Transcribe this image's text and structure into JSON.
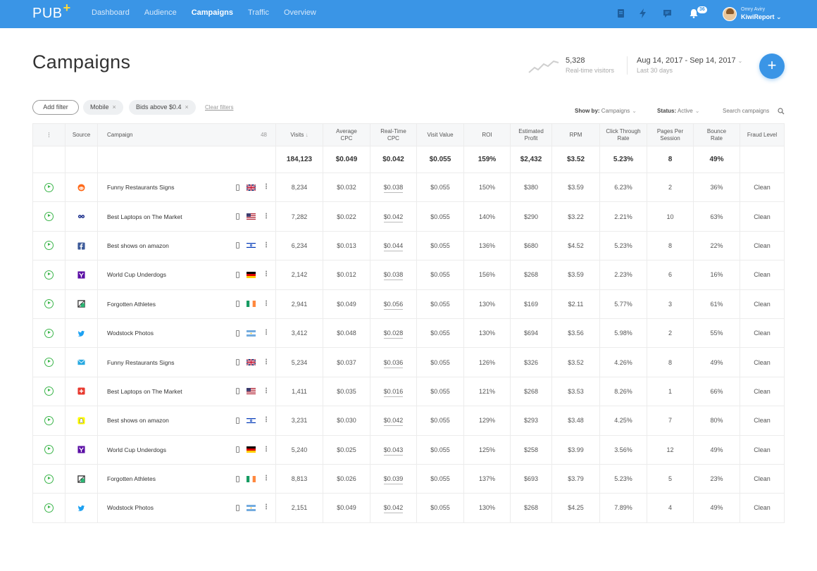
{
  "topbar": {
    "logo": "PUB",
    "logo_plus": "+",
    "nav": [
      "Dashboard",
      "Audience",
      "Campaigns",
      "Traffic",
      "Overview"
    ],
    "active_nav": "Campaigns",
    "notification_count": "36",
    "user_small": "Omry Aviry",
    "user_name": "KiwiReport",
    "user_chevron": "⌄",
    "icons": [
      "book-icon",
      "bolt-icon",
      "chat-icon",
      "bell-icon"
    ]
  },
  "header": {
    "title": "Campaigns",
    "realtime_value": "5,328",
    "realtime_label": "Real-time visitors",
    "date_range": "Aug 14, 2017 - Sep 14, 2017",
    "date_sub": "Last 30 days",
    "fab": "+"
  },
  "filters": {
    "add_filter": "Add filter",
    "chips": [
      "Mobile",
      "Bids above $0.4"
    ],
    "clear": "Clear filters",
    "show_by_label": "Show by:",
    "show_by_value": "Campaigns",
    "status_label": "Status:",
    "status_value": "Active",
    "search_placeholder": "Search campaigns"
  },
  "table": {
    "headers": {
      "source": "Source",
      "campaign": "Campaign",
      "campaign_count": "48",
      "visits": "Visits",
      "avg_cpc": [
        "Average",
        "CPC"
      ],
      "rt_cpc": [
        "Real-Time",
        "CPC"
      ],
      "visit_value": "Visit Value",
      "roi": "ROI",
      "est_profit": [
        "Estimated",
        "Profit"
      ],
      "rpm": "RPM",
      "ctr": [
        "Click Through",
        "Rate"
      ],
      "pps": [
        "Pages Per",
        "Session"
      ],
      "bounce": [
        "Bounce",
        "Rate"
      ],
      "fraud": "Fraud Level"
    },
    "totals": {
      "visits": "184,123",
      "avg_cpc": "$0.049",
      "rt_cpc": "$0.042",
      "visit_value": "$0.055",
      "roi": "159%",
      "est_profit": "$2,432",
      "rpm": "$3.52",
      "ctr": "5.23%",
      "pps": "8",
      "bounce": "49%"
    },
    "rows": [
      {
        "source": "reddit-icon",
        "campaign": "Funny Restaurants Signs",
        "flag": "uk",
        "visits": "8,234",
        "avg_cpc": "$0.032",
        "rt_cpc": "$0.038",
        "visit_value": "$0.055",
        "roi": "150%",
        "roi_color": "green",
        "est_profit": "$380",
        "rpm": "$3.59",
        "ctr": "6.23%",
        "pps": "2",
        "bounce": "36%",
        "fraud": "Clean"
      },
      {
        "source": "flickr-icon",
        "campaign": "Best Laptops on The Market",
        "flag": "us",
        "visits": "7,282",
        "avg_cpc": "$0.022",
        "rt_cpc": "$0.042",
        "visit_value": "$0.055",
        "roi": "140%",
        "roi_color": "green",
        "est_profit": "$290",
        "rpm": "$3.22",
        "ctr": "2.21%",
        "pps": "10",
        "bounce": "63%",
        "fraud": "Clean"
      },
      {
        "source": "facebook-icon",
        "campaign": "Best shows on amazon",
        "flag": "il",
        "visits": "6,234",
        "avg_cpc": "$0.013",
        "rt_cpc": "$0.044",
        "visit_value": "$0.055",
        "roi": "136%",
        "roi_color": "green",
        "est_profit": "$680",
        "rpm": "$4.52",
        "ctr": "5.23%",
        "pps": "8",
        "bounce": "22%",
        "fraud": "Clean"
      },
      {
        "source": "yahoo-icon",
        "campaign": "World Cup Underdogs",
        "flag": "de",
        "visits": "2,142",
        "avg_cpc": "$0.012",
        "rt_cpc": "$0.038",
        "visit_value": "$0.055",
        "roi": "156%",
        "roi_color": "green",
        "est_profit": "$268",
        "rpm": "$3.59",
        "ctr": "2.23%",
        "pps": "6",
        "bounce": "16%",
        "fraud": "Clean"
      },
      {
        "source": "bracket-icon",
        "campaign": "Forgotten Athletes",
        "flag": "ie",
        "visits": "2,941",
        "avg_cpc": "$0.049",
        "rt_cpc": "$0.056",
        "visit_value": "$0.055",
        "roi": "130%",
        "roi_color": "green",
        "est_profit": "$169",
        "rpm": "$2.11",
        "ctr": "5.77%",
        "pps": "3",
        "bounce": "61%",
        "fraud": "Clean"
      },
      {
        "source": "twitter-icon",
        "campaign": "Wodstock Photos",
        "flag": "ar",
        "visits": "3,412",
        "avg_cpc": "$0.048",
        "rt_cpc": "$0.028",
        "visit_value": "$0.055",
        "roi": "130%",
        "roi_color": "orange",
        "est_profit": "$694",
        "rpm": "$3.56",
        "ctr": "5.98%",
        "pps": "2",
        "bounce": "55%",
        "fraud": "Clean"
      },
      {
        "source": "mail-icon",
        "campaign": "Funny Restaurants Signs",
        "flag": "uk",
        "visits": "5,234",
        "avg_cpc": "$0.037",
        "rt_cpc": "$0.036",
        "visit_value": "$0.055",
        "roi": "126%",
        "roi_color": "orange",
        "est_profit": "$326",
        "rpm": "$3.52",
        "ctr": "4.26%",
        "pps": "8",
        "bounce": "49%",
        "fraud": "Clean"
      },
      {
        "source": "plus-icon",
        "campaign": "Best Laptops on The Market",
        "flag": "us",
        "visits": "1,411",
        "avg_cpc": "$0.035",
        "rt_cpc": "$0.016",
        "visit_value": "$0.055",
        "roi": "121%",
        "roi_color": "orange",
        "est_profit": "$268",
        "rpm": "$3.53",
        "ctr": "8.26%",
        "pps": "1",
        "bounce": "66%",
        "fraud": "Clean"
      },
      {
        "source": "snapchat-icon",
        "campaign": "Best shows on amazon",
        "flag": "il",
        "visits": "3,231",
        "avg_cpc": "$0.030",
        "rt_cpc": "$0.042",
        "visit_value": "$0.055",
        "roi": "129%",
        "roi_color": "orange",
        "est_profit": "$293",
        "rpm": "$3.48",
        "ctr": "4.25%",
        "pps": "7",
        "bounce": "80%",
        "fraud": "Clean"
      },
      {
        "source": "yahoo-icon",
        "campaign": "World Cup Underdogs",
        "flag": "de",
        "visits": "5,240",
        "avg_cpc": "$0.025",
        "rt_cpc": "$0.043",
        "visit_value": "$0.055",
        "roi": "125%",
        "roi_color": "orange",
        "est_profit": "$258",
        "rpm": "$3.99",
        "ctr": "3.56%",
        "pps": "12",
        "bounce": "49%",
        "fraud": "Clean"
      },
      {
        "source": "bracket-icon",
        "campaign": "Forgotten Athletes",
        "flag": "ie",
        "visits": "8,813",
        "avg_cpc": "$0.026",
        "rt_cpc": "$0.039",
        "visit_value": "$0.055",
        "roi": "137%",
        "roi_color": "orange",
        "est_profit": "$693",
        "rpm": "$3.79",
        "ctr": "5.23%",
        "pps": "5",
        "bounce": "23%",
        "fraud": "Clean"
      },
      {
        "source": "twitter-icon",
        "campaign": "Wodstock Photos",
        "flag": "ar",
        "visits": "2,151",
        "avg_cpc": "$0.049",
        "rt_cpc": "$0.042",
        "visit_value": "$0.055",
        "roi": "130%",
        "roi_color": "orange",
        "est_profit": "$268",
        "rpm": "$4.25",
        "ctr": "7.89%",
        "pps": "4",
        "bounce": "49%",
        "fraud": "Clean"
      }
    ]
  },
  "colors": {
    "brand": "#3a95e6",
    "roi_green": "#3bb54a",
    "roi_orange": "#f07a23",
    "logo_plus": "#ffd93b"
  }
}
